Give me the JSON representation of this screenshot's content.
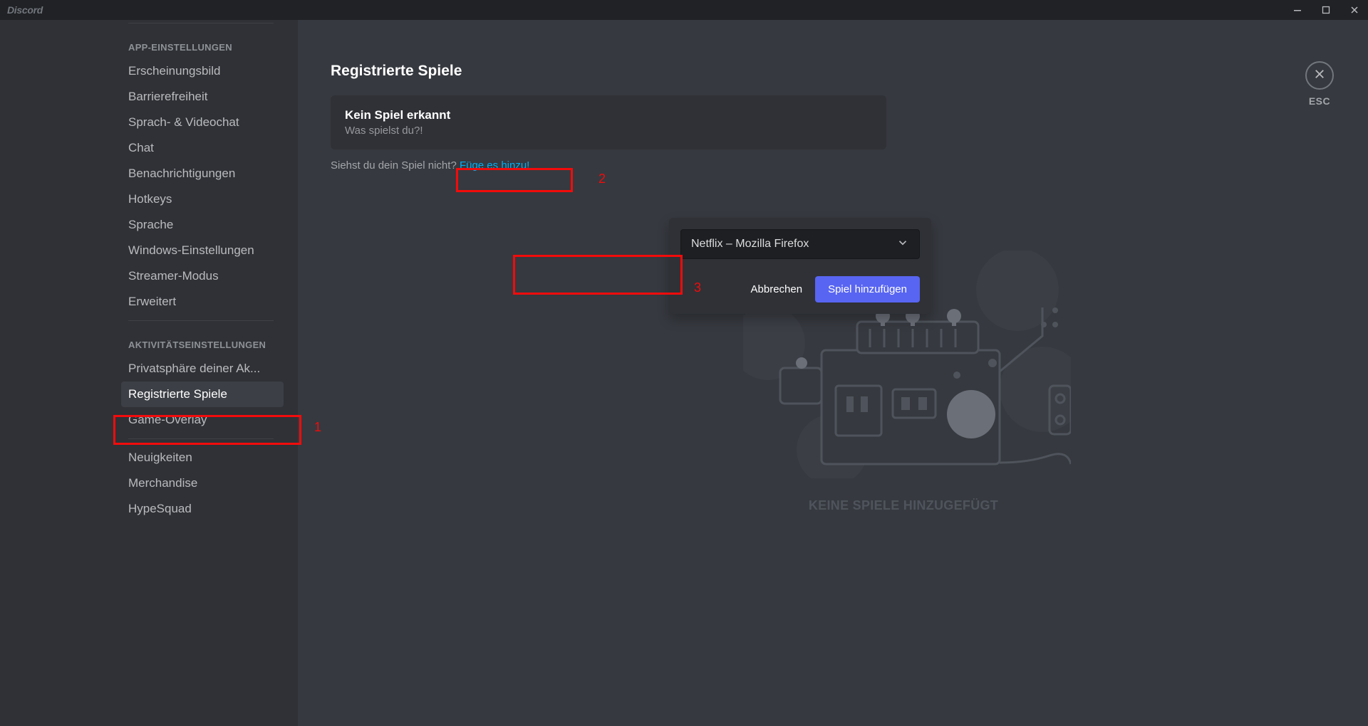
{
  "titlebar": {
    "brand": "Discord"
  },
  "sidebar": {
    "cat_app": "APP-EINSTELLUNGEN",
    "cat_activity": "AKTIVITÄTSEINSTELLUNGEN",
    "items": {
      "appearance": "Erscheinungsbild",
      "accessibility": "Barrierefreiheit",
      "voice": "Sprach- & Videochat",
      "chat": "Chat",
      "notifications": "Benachrichtigungen",
      "hotkeys": "Hotkeys",
      "language": "Sprache",
      "windows": "Windows-Einstellungen",
      "streamer": "Streamer-Modus",
      "advanced": "Erweitert",
      "privacy_activity": "Privatsphäre deiner Ak...",
      "registered_games": "Registrierte Spiele",
      "overlay": "Game-Overlay",
      "news": "Neuigkeiten",
      "merch": "Merchandise",
      "hypesquad": "HypeSquad"
    }
  },
  "main": {
    "page_title": "Registrierte Spiele",
    "card_title": "Kein Spiel erkannt",
    "card_sub": "Was spielst du?!",
    "prompt_prefix": "Siehst du dein Spiel nicht? ",
    "prompt_link": "Füge es hinzu!",
    "empty_label": "KEINE SPIELE HINZUGEFÜGT"
  },
  "popover": {
    "selected": "Netflix – Mozilla Firefox",
    "cancel": "Abbrechen",
    "add": "Spiel hinzufügen"
  },
  "close": {
    "esc": "ESC"
  },
  "annotations": {
    "one": "1",
    "two": "2",
    "three": "3"
  }
}
